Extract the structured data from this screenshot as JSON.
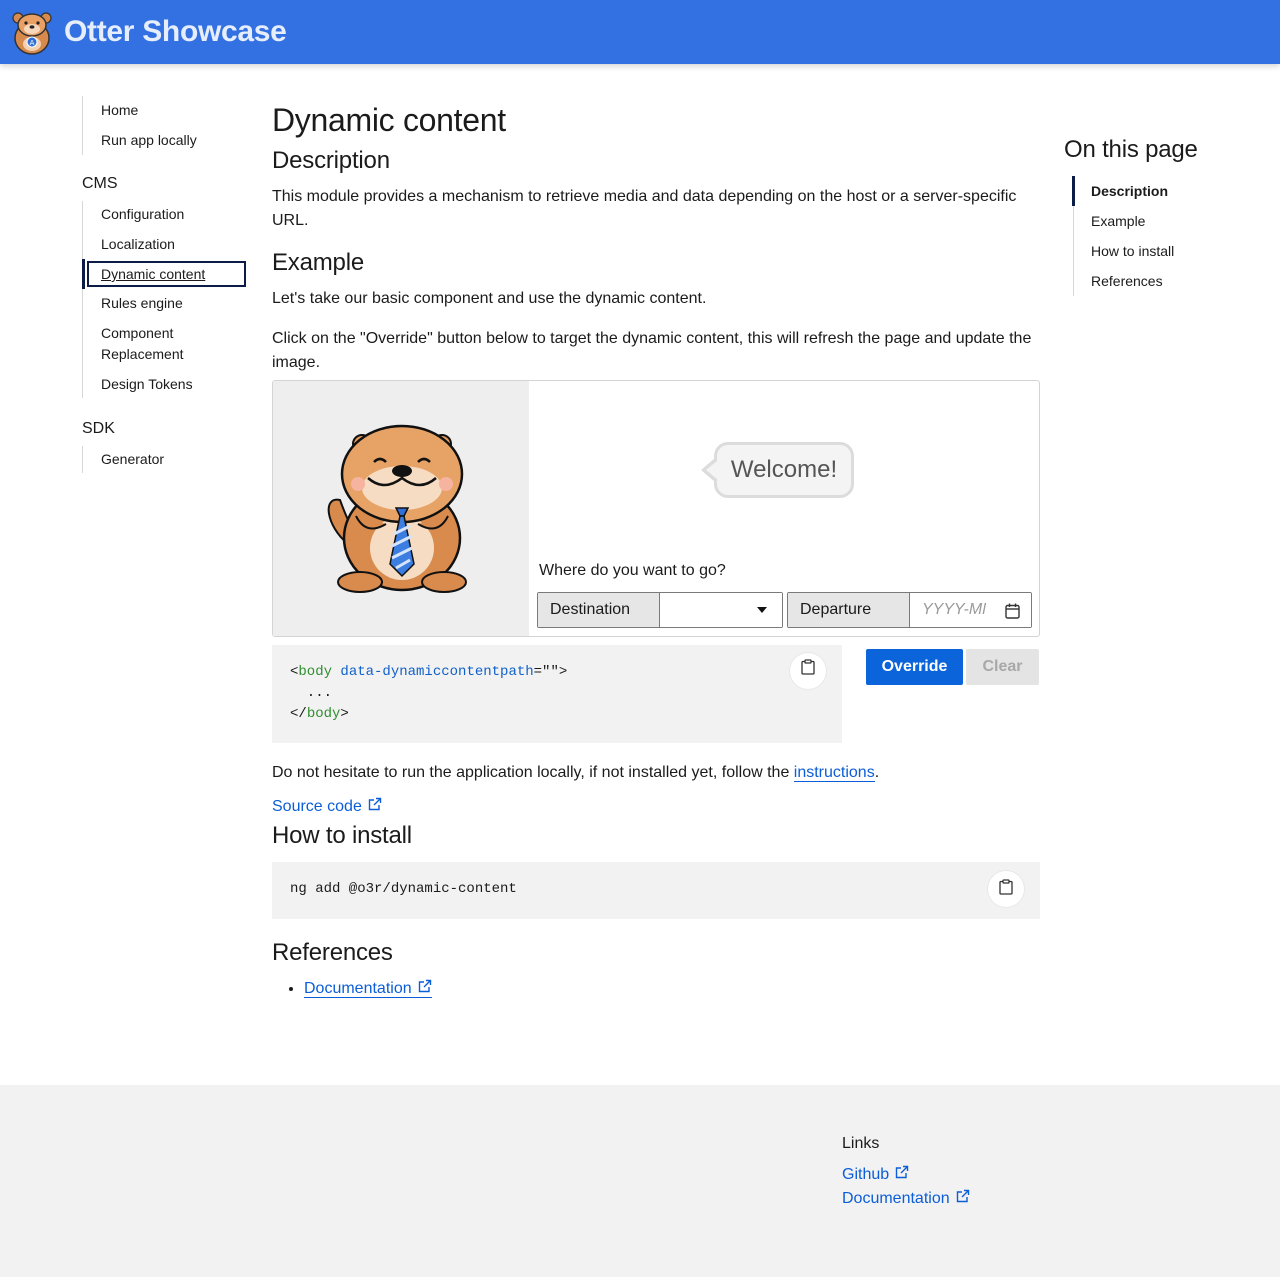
{
  "header": {
    "brand": "Otter Showcase"
  },
  "sidebar": {
    "top_items": [
      {
        "label": "Home"
      },
      {
        "label": "Run app locally"
      }
    ],
    "cms": {
      "title": "CMS",
      "items": [
        {
          "label": "Configuration"
        },
        {
          "label": "Localization"
        },
        {
          "label": "Dynamic content",
          "active": true
        },
        {
          "label": "Rules engine"
        },
        {
          "label": "Component Replacement"
        },
        {
          "label": "Design Tokens"
        }
      ]
    },
    "sdk": {
      "title": "SDK",
      "items": [
        {
          "label": "Generator"
        }
      ]
    }
  },
  "main": {
    "title": "Dynamic content",
    "description": {
      "heading": "Description",
      "text": "This module provides a mechanism to retrieve media and data depending on the host or a server-specific URL."
    },
    "example": {
      "heading": "Example",
      "text1": "Let's take our basic component and use the dynamic content.",
      "text2": "Click on the \"Override\" button below to target the dynamic content, this will refresh the page and update the image.",
      "demo": {
        "welcome": "Welcome!",
        "question": "Where do you want to go?",
        "destination_label": "Destination",
        "departure_label": "Departure",
        "departure_placeholder": "YYYY-MM-DD"
      },
      "code": {
        "line1_open": "<",
        "line1_tag": "body",
        "line1_attr": "data-dynamiccontentpath",
        "line1_eq": "=\"\">",
        "line2": "  ...",
        "line3_open": "</",
        "line3_tag": "body",
        "line3_close": ">"
      },
      "override_label": "Override",
      "clear_label": "Clear",
      "hint_before": "Do not hesitate to run the application locally, if not installed yet, follow the ",
      "hint_link": "instructions",
      "hint_after": ".",
      "source_code": "Source code"
    },
    "install": {
      "heading": "How to install",
      "command": "ng add @o3r/dynamic-content"
    },
    "references": {
      "heading": "References",
      "items": [
        {
          "label": "Documentation"
        }
      ]
    }
  },
  "toc": {
    "title": "On this page",
    "items": [
      {
        "label": "Description",
        "active": true
      },
      {
        "label": "Example"
      },
      {
        "label": "How to install"
      },
      {
        "label": "References"
      }
    ]
  },
  "footer": {
    "title": "Links",
    "links": [
      {
        "label": "Github"
      },
      {
        "label": "Documentation"
      }
    ]
  },
  "colors": {
    "header": "#3370e2",
    "primary_button": "#0b64d9",
    "link": "#0b5ed7",
    "active_marker": "#0b1c46"
  }
}
